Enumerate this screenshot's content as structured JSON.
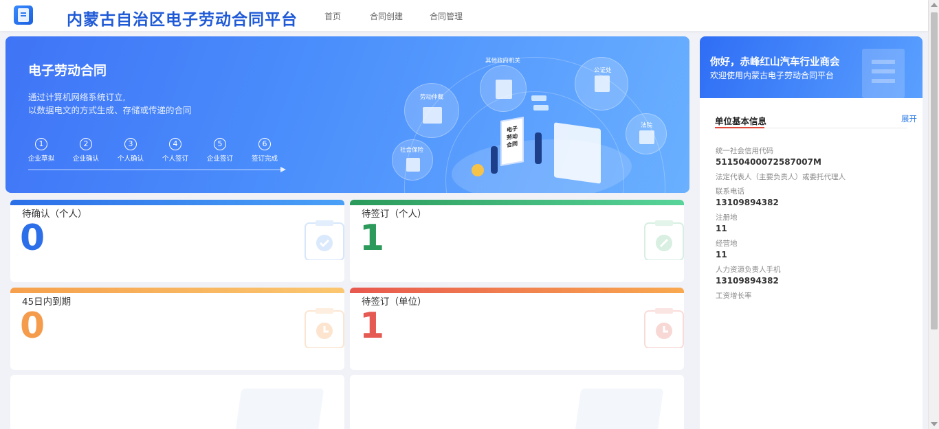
{
  "header": {
    "title": "内蒙古自治区电子劳动合同平台",
    "nav": [
      {
        "label": "首页"
      },
      {
        "label": "合同创建"
      },
      {
        "label": "合同管理"
      }
    ]
  },
  "banner": {
    "title": "电子劳动合同",
    "desc_line1": "通过计算机网络系统订立,",
    "desc_line2": "以数据电文的方式生成、存储或传递的合同",
    "steps": [
      {
        "num": "1",
        "label": "企业草拟"
      },
      {
        "num": "2",
        "label": "企业确认"
      },
      {
        "num": "3",
        "label": "个人确认"
      },
      {
        "num": "4",
        "label": "个人签订"
      },
      {
        "num": "5",
        "label": "企业签订"
      },
      {
        "num": "6",
        "label": "签订完成"
      }
    ],
    "illustration": {
      "labels": [
        "其他政府机关",
        "公证处",
        "劳动仲裁",
        "法院",
        "社会保险"
      ],
      "board_text": [
        "电子",
        "劳动",
        "合同"
      ]
    }
  },
  "cards": [
    {
      "title": "待确认（个人）",
      "value": "0",
      "color": "#2c6fe8",
      "bar": "#3a85f0",
      "icon": "check-clipboard-icon"
    },
    {
      "title": "待签订（个人）",
      "value": "1",
      "color": "#2b9a5a",
      "bar": "#3fb77a",
      "icon": "pen-clipboard-icon"
    },
    {
      "title": "45日内到期",
      "value": "0",
      "color": "#f59b4c",
      "bar": "#f9a94f",
      "icon": "clock-clipboard-icon"
    },
    {
      "title": "待签订（单位）",
      "value": "1",
      "color": "#e55a52",
      "bar": "#ee6c5a",
      "icon": "clock-clipboard-icon"
    }
  ],
  "panel": {
    "greeting": "你好，赤峰红山汽车行业商会",
    "subtitle": "欢迎使用内蒙古电子劳动合同平台",
    "tab": "单位基本信息",
    "expand": "展开",
    "fields": [
      {
        "label": "统一社会信用代码",
        "value": "51150400072587007M"
      },
      {
        "label": "法定代表人（主要负责人）或委托代理人",
        "value": ""
      },
      {
        "label": "联系电话",
        "value": "13109894382"
      },
      {
        "label": "注册地",
        "value": "11"
      },
      {
        "label": "经营地",
        "value": "11"
      },
      {
        "label": "人力资源负责人手机",
        "value": "13109894382"
      },
      {
        "label": "工资增长率",
        "value": ""
      }
    ]
  }
}
